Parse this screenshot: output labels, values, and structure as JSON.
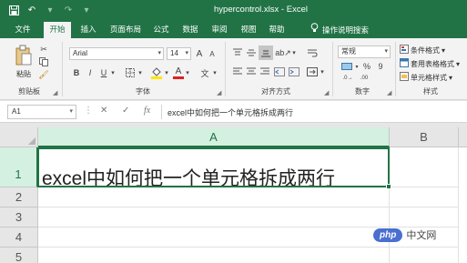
{
  "window": {
    "title": "hypercontrol.xlsx  -  Excel",
    "accent": "#217346"
  },
  "qat": {
    "save_icon": "save-icon",
    "undo_icon": "undo-icon",
    "redo_icon": "redo-icon"
  },
  "tabs": [
    {
      "label": "文件",
      "active": false
    },
    {
      "label": "开始",
      "active": true
    },
    {
      "label": "插入",
      "active": false
    },
    {
      "label": "页面布局",
      "active": false
    },
    {
      "label": "公式",
      "active": false
    },
    {
      "label": "数据",
      "active": false
    },
    {
      "label": "审阅",
      "active": false
    },
    {
      "label": "视图",
      "active": false
    },
    {
      "label": "帮助",
      "active": false
    }
  ],
  "tellme": "操作说明搜索",
  "ribbon": {
    "clipboard": {
      "paste_label": "粘贴",
      "group": "剪贴板"
    },
    "font": {
      "name": "Arial",
      "size": "14",
      "bold": "B",
      "italic": "I",
      "underline": "U",
      "grow": "A",
      "shrink": "A",
      "color_a": "A",
      "phonetic": "文",
      "group": "字体"
    },
    "alignment": {
      "group": "对齐方式"
    },
    "number": {
      "format": "常规",
      "percent": "%",
      "comma": "9",
      "group": "数字"
    },
    "styles": {
      "conditional": "条件格式",
      "table": "套用表格格式",
      "cell": "单元格样式",
      "group": "样式"
    }
  },
  "formula_bar": {
    "name_box": "A1",
    "cancel": "✕",
    "enter": "✓",
    "fx": "fx",
    "content": "excel中如何把一个单元格拆成两行"
  },
  "sheet": {
    "columns": [
      "A",
      "B"
    ],
    "rows": [
      "1",
      "2",
      "3",
      "4",
      "5"
    ],
    "a1_value": "excel中如何把一个单元格拆成两行"
  },
  "watermark": {
    "logo": "php",
    "site": "中文网"
  }
}
